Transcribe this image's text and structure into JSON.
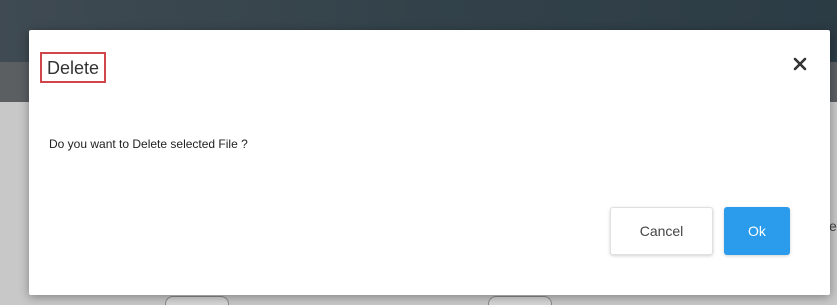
{
  "dialog": {
    "title": "Delete",
    "message": "Do you want to Delete selected File ?",
    "close_icon": "close-icon",
    "buttons": {
      "cancel_label": "Cancel",
      "ok_label": "Ok"
    },
    "colors": {
      "ok_button": "#2b9cec",
      "title_highlight_border": "#d0464a"
    }
  },
  "background": {
    "right_edge_text": "e"
  }
}
